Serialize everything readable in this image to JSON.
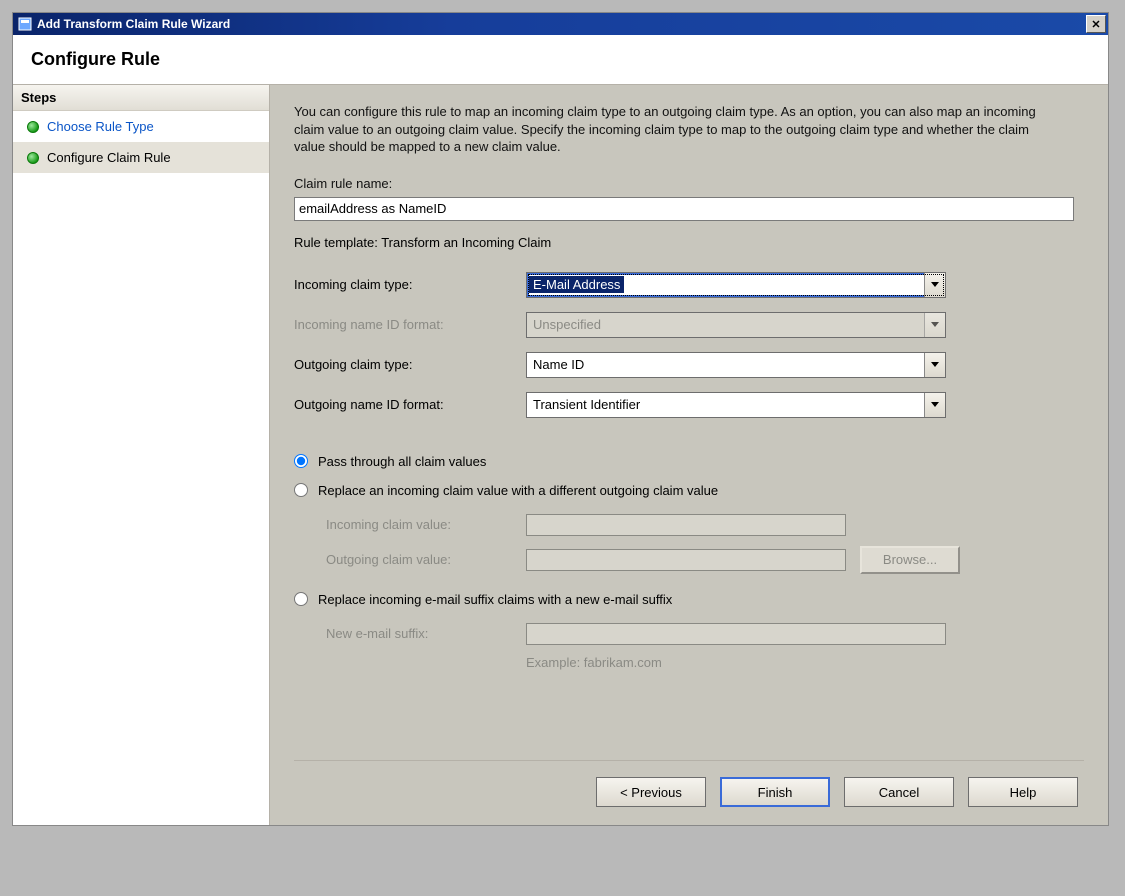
{
  "window": {
    "title": "Add Transform Claim Rule Wizard"
  },
  "header": {
    "title": "Configure Rule"
  },
  "sidebar": {
    "steps_label": "Steps",
    "items": [
      {
        "label": "Choose Rule Type",
        "active_link": true
      },
      {
        "label": "Configure Claim Rule",
        "active_link": false
      }
    ]
  },
  "content": {
    "intro": "You can configure this rule to map an incoming claim type to an outgoing claim type. As an option, you can also map an incoming claim value to an outgoing claim value. Specify the incoming claim type to map to the outgoing claim type and whether the claim value should be mapped to a new claim value.",
    "claim_rule_name_label": "Claim rule name:",
    "claim_rule_name_value": "emailAddress as NameID",
    "rule_template_prefix": "Rule template: ",
    "rule_template_value": "Transform an Incoming Claim",
    "rows": {
      "incoming_claim_type_label": "Incoming claim type:",
      "incoming_claim_type_value": "E-Mail Address",
      "incoming_name_id_format_label": "Incoming name ID format:",
      "incoming_name_id_format_value": "Unspecified",
      "outgoing_claim_type_label": "Outgoing claim type:",
      "outgoing_claim_type_value": "Name ID",
      "outgoing_name_id_format_label": "Outgoing name ID format:",
      "outgoing_name_id_format_value": "Transient Identifier"
    },
    "radios": {
      "pass_through": "Pass through all claim values",
      "replace_value": "Replace an incoming claim value with a different outgoing claim value",
      "replace_suffix": "Replace incoming e-mail suffix claims with a new e-mail suffix"
    },
    "sub": {
      "incoming_claim_value_label": "Incoming claim value:",
      "outgoing_claim_value_label": "Outgoing claim value:",
      "browse_label": "Browse...",
      "new_email_suffix_label": "New e-mail suffix:",
      "example_hint": "Example: fabrikam.com"
    }
  },
  "buttons": {
    "previous": "< Previous",
    "finish": "Finish",
    "cancel": "Cancel",
    "help": "Help"
  }
}
